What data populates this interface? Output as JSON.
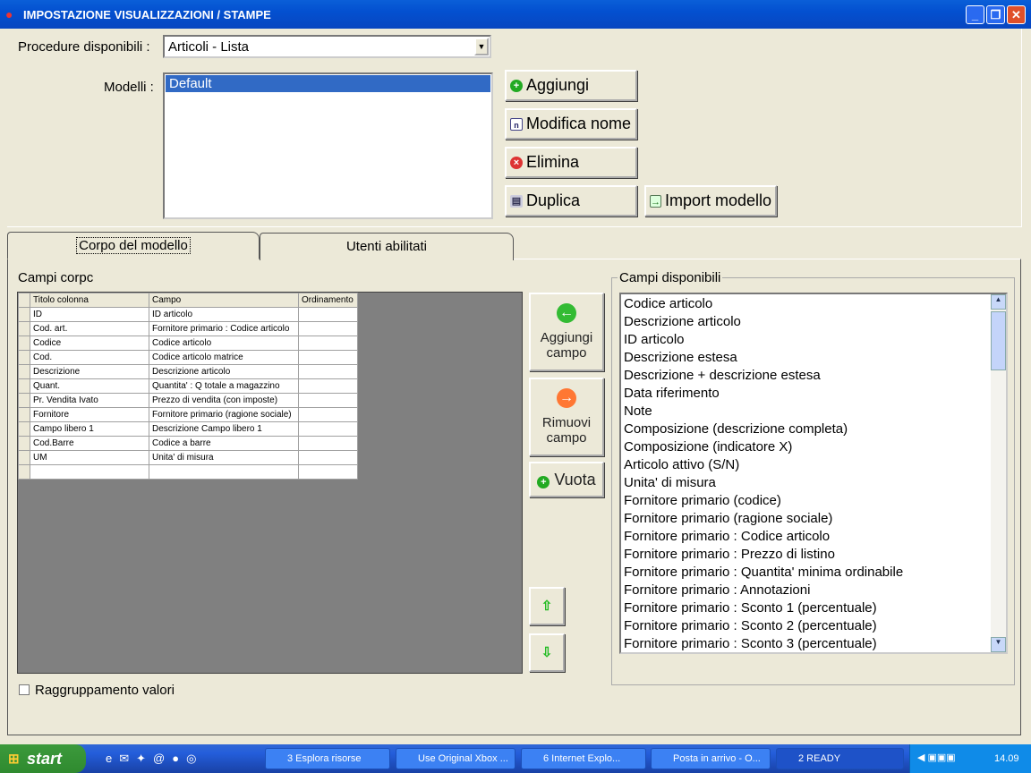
{
  "window": {
    "title": "IMPOSTAZIONE VISUALIZZAZIONI / STAMPE",
    "min": "_",
    "max": "❐",
    "close": "✕"
  },
  "procedure": {
    "label": "Procedure disponibili :",
    "value": "Articoli - Lista"
  },
  "models": {
    "label": "Modelli :",
    "items": [
      "Default"
    ]
  },
  "buttons": {
    "add": "Aggiungi",
    "rename": "Modifica nome",
    "delete": "Elimina",
    "duplicate": "Duplica",
    "import": "Import modello"
  },
  "tabs": [
    {
      "label": "Corpo del modello",
      "active": true
    },
    {
      "label": "Utenti abilitati",
      "active": false
    }
  ],
  "body_fields": {
    "label": "Campi corpc",
    "columns": [
      "Titolo colonna",
      "Campo",
      "Ordinamento"
    ],
    "rows": [
      [
        "ID",
        "ID articolo",
        ""
      ],
      [
        "Cod. art.",
        "Fornitore primario : Codice articolo",
        ""
      ],
      [
        "Codice",
        "Codice articolo",
        ""
      ],
      [
        "Cod.",
        "Codice articolo matrice",
        ""
      ],
      [
        "Descrizione",
        "Descrizione articolo",
        ""
      ],
      [
        "Quant.",
        "Quantita' : Q totale a magazzino",
        ""
      ],
      [
        "Pr. Vendita Ivato",
        "Prezzo di vendita (con imposte)",
        ""
      ],
      [
        "Fornitore",
        "Fornitore primario (ragione sociale)",
        ""
      ],
      [
        "Campo libero 1",
        "Descrizione Campo libero 1",
        ""
      ],
      [
        "Cod.Barre",
        "Codice a barre",
        ""
      ],
      [
        "UM",
        "Unita' di misura",
        ""
      ],
      [
        "",
        "",
        ""
      ]
    ]
  },
  "side_buttons": {
    "add_line1": "Aggiungi",
    "add_line2": "campo",
    "remove_line1": "Rimuovi",
    "remove_line2": "campo",
    "empty": "Vuota"
  },
  "grouping": {
    "label": "Raggruppamento valori",
    "checked": false
  },
  "available": {
    "label": "Campi disponibili",
    "items": [
      "Codice articolo",
      "Descrizione articolo",
      "ID articolo",
      "Descrizione estesa",
      "Descrizione + descrizione estesa",
      "Data riferimento",
      "Note",
      "Composizione (descrizione completa)",
      "Composizione (indicatore X)",
      "Articolo attivo (S/N)",
      "Unita' di misura",
      "Fornitore primario (codice)",
      "Fornitore primario (ragione sociale)",
      "Fornitore primario : Codice articolo",
      "Fornitore primario : Prezzo di listino",
      "Fornitore primario : Quantita' minima ordinabile",
      "Fornitore primario : Annotazioni",
      "Fornitore primario : Sconto 1 (percentuale)",
      "Fornitore primario : Sconto 2 (percentuale)",
      "Fornitore primario : Sconto 3 (percentuale)"
    ]
  },
  "taskbar": {
    "start": "start",
    "tasks": [
      "3 Esplora risorse",
      "Use Original Xbox ...",
      "6 Internet Explo...",
      "Posta in arrivo - O...",
      "2 READY"
    ],
    "clock": "14.09"
  }
}
